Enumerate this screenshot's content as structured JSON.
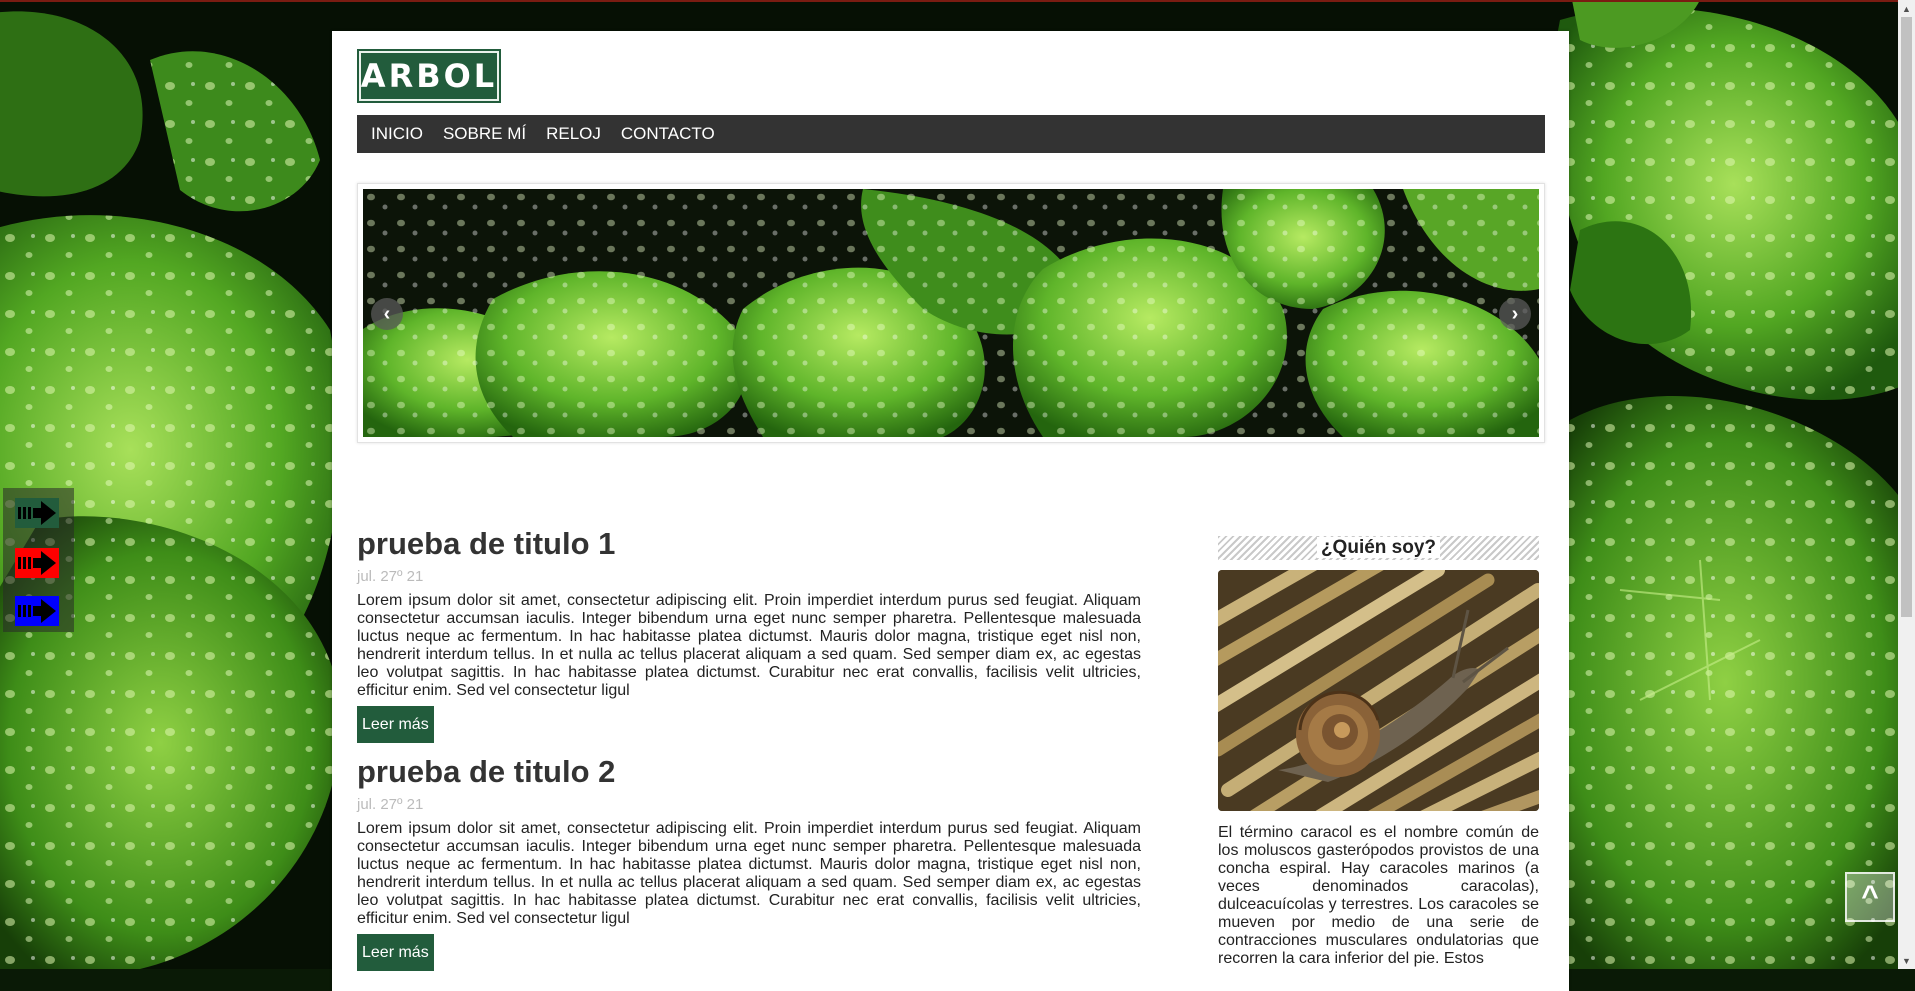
{
  "site": {
    "logo": "ARBOL"
  },
  "nav": {
    "items": [
      {
        "label": "INICIO"
      },
      {
        "label": "SOBRE MÍ"
      },
      {
        "label": "RELOJ"
      },
      {
        "label": "CONTACTO"
      }
    ]
  },
  "slider": {
    "prev_icon": "chevron-left-icon",
    "next_icon": "chevron-right-icon"
  },
  "posts": [
    {
      "title": "prueba de titulo 1",
      "date": "jul. 27º 21",
      "body": "Lorem ipsum dolor sit amet, consectetur adipiscing elit. Proin imperdiet interdum purus sed feugiat. Aliquam consectetur accumsan iaculis. Integer bibendum urna eget nunc semper pharetra. Pellentesque malesuada luctus neque ac fermentum. In hac habitasse platea dictumst. Mauris dolor magna, tristique eget nisl non, hendrerit interdum tellus. In et nulla ac tellus placerat aliquam a sed quam. Sed semper diam ex, ac egestas leo volutpat sagittis. In hac habitasse platea dictumst. Curabitur nec erat convallis, facilisis velit ultricies, efficitur enim. Sed vel consectetur ligul",
      "read_more": "Leer más"
    },
    {
      "title": "prueba de titulo 2",
      "date": "jul. 27º 21",
      "body": "Lorem ipsum dolor sit amet, consectetur adipiscing elit. Proin imperdiet interdum purus sed feugiat. Aliquam consectetur accumsan iaculis. Integer bibendum urna eget nunc semper pharetra. Pellentesque malesuada luctus neque ac fermentum. In hac habitasse platea dictumst. Mauris dolor magna, tristique eget nisl non, hendrerit interdum tellus. In et nulla ac tellus placerat aliquam a sed quam. Sed semper diam ex, ac egestas leo volutpat sagittis. In hac habitasse platea dictumst. Curabitur nec erat convallis, facilisis velit ultricies, efficitur enim. Sed vel consectetur ligul",
      "read_more": "Leer más"
    }
  ],
  "sidebar": {
    "title": "¿Quién soy?",
    "text": "El término caracol es el nombre común de los moluscos gasterópodos provistos de una concha espiral. Hay caracoles marinos (a veces denominados caracolas), dulceacuícolas y terrestres. Los caracoles se mueven por medio de una serie de contracciones musculares ondulatorias que recorren la cara inferior del pie. Estos"
  },
  "theme_switchers": [
    {
      "color": "#225c3c",
      "icon": "arrow-right-icon"
    },
    {
      "color": "#ff0000",
      "icon": "arrow-right-icon"
    },
    {
      "color": "#0000ff",
      "icon": "arrow-right-icon"
    }
  ],
  "back_to_top": {
    "label": "^"
  },
  "colors": {
    "accent": "#225c3c",
    "nav_bg": "#333333",
    "date": "#bbbbbb"
  }
}
